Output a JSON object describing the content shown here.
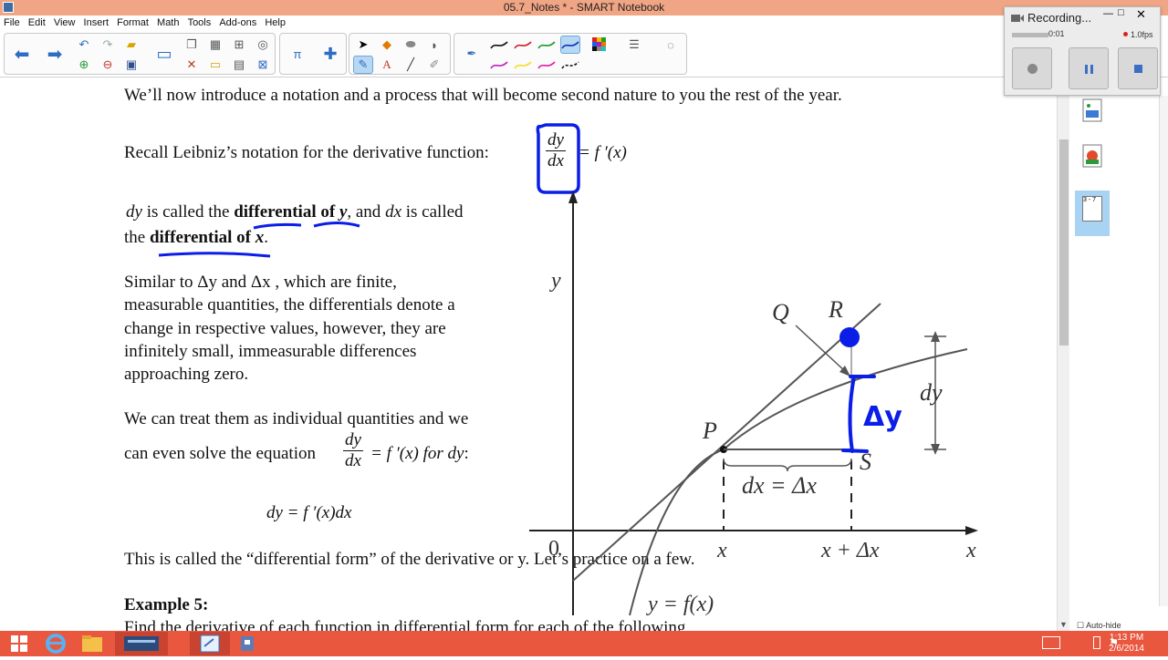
{
  "window": {
    "title": "05.7_Notes * - SMART Notebook",
    "menus": [
      "File",
      "Edit",
      "View",
      "Insert",
      "Format",
      "Math",
      "Tools",
      "Add-ons",
      "Help"
    ]
  },
  "recorder": {
    "title": "Recording...",
    "elapsed": "0:01",
    "fps": "1.0fps"
  },
  "document": {
    "intro": "We’ll now introduce a notation and a process that will become second nature to you the rest of the year.",
    "recall_text": "Recall Leibniz’s notation for the derivative function:",
    "recall_num": "dy",
    "recall_den": "dx",
    "recall_rhs": "= f ′(x)",
    "diff_line1_a": "dy",
    "diff_line1_b": " is called the ",
    "diff_line1_bold": "differential of ",
    "diff_line1_boldvar": "y",
    "diff_line1_c": ", and ",
    "diff_line1_d": "dx",
    "diff_line1_e": " is called",
    "diff_line2_a": "the ",
    "diff_line2_bold": "differential of ",
    "diff_line2_boldvar": "x",
    "diff_line2_end": ".",
    "similar_lines": [
      "Similar to  Δy  and  Δx , which are finite,",
      "measurable quantities, the differentials denote a",
      "change in respective values, however, they are",
      "infinitely small, immeasurable differences",
      "approaching zero."
    ],
    "treat_line1": "We can treat them as individual quantities and we",
    "treat_line2_a": "can even solve the equation",
    "treat_num": "dy",
    "treat_den": "dx",
    "treat_rhs": "= f ′(x)  for ",
    "treat_var": "dy",
    "treat_colon": ":",
    "formula": "dy = f ′(x)dx",
    "called": "This is called the “differential form” of the derivative or y.  Let’s practice on a few.",
    "example_label": "Example 5:",
    "example_text": "Find the derivative of each function in differential form for each of the following"
  },
  "graph": {
    "y_axis": "y",
    "x_axis": "x",
    "origin": "0",
    "Q": "Q",
    "R": "R",
    "P": "P",
    "S": "S",
    "dy": "dy",
    "dx_eq": "dx = Δx",
    "x_tick": "x",
    "x_plus_tick": "x + Δx",
    "curve_label": "y = f(x)",
    "handwritten": "Δy"
  },
  "sidepanel": {
    "page_label": "3 - 7",
    "autohide": "Auto-hide"
  },
  "taskbar": {
    "time": "1:13 PM",
    "date": "2/6/2014"
  },
  "colors": {
    "ink_blue": "#0a1ee8",
    "title_bar": "#f0a585",
    "taskbar": "#e9573f"
  }
}
